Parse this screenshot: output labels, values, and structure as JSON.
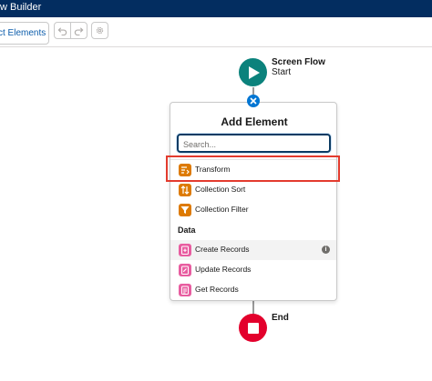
{
  "app": {
    "title": "w Builder"
  },
  "toolbar": {
    "select_elements_label": "ct Elements"
  },
  "canvas": {
    "start": {
      "title": "Screen Flow",
      "subtitle": "Start"
    },
    "end": {
      "label": "End"
    }
  },
  "panel": {
    "title": "Add Element",
    "search": {
      "placeholder": "Search...",
      "value": ""
    },
    "items": [
      {
        "label": "Transform",
        "icon": "transform-icon",
        "color": "#dd7a01"
      },
      {
        "label": "Collection Sort",
        "icon": "sort-icon",
        "color": "#dd7a01"
      },
      {
        "label": "Collection Filter",
        "icon": "filter-icon",
        "color": "#dd7a01"
      }
    ],
    "data_section": {
      "label": "Data",
      "items": [
        {
          "label": "Create Records",
          "icon": "create-records-icon",
          "color": "#e85da0",
          "info": "i"
        },
        {
          "label": "Update Records",
          "icon": "update-records-icon",
          "color": "#e85da0"
        },
        {
          "label": "Get Records",
          "icon": "get-records-icon",
          "color": "#e85da0"
        }
      ]
    }
  },
  "colors": {
    "app_bar": "#032d60",
    "start_node": "#0b827c",
    "end_node": "#e3002c",
    "highlight": "#e33b2e",
    "accent": "#0176d3"
  }
}
